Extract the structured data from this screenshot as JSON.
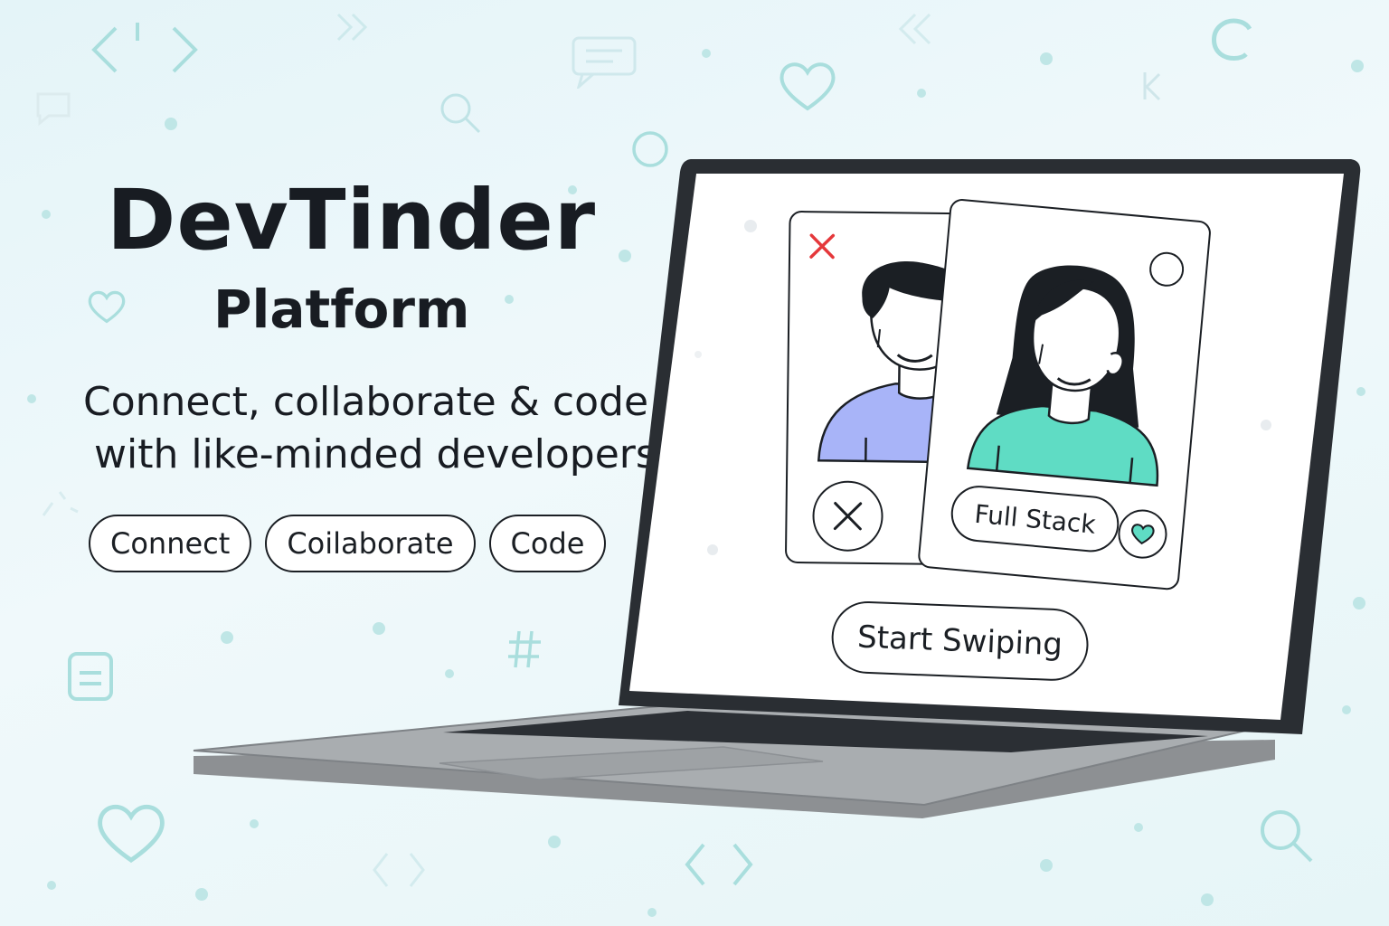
{
  "app": {
    "title": "DevTinder",
    "subtitle": "Platform",
    "tagline_line1": "Connect, collaborate & code",
    "tagline_line2": "with like-minded developers"
  },
  "pills": [
    {
      "label": "Connect"
    },
    {
      "label": "Coilaborate"
    },
    {
      "label": "Code"
    }
  ],
  "screen": {
    "left_card": {
      "reject_icon": "x-icon",
      "avatar": "male-developer-avatar",
      "shirt_color": "#a8b4f8"
    },
    "right_card": {
      "avatar": "female-developer-avatar",
      "shirt_color": "#5fdcc4",
      "badge": "Full Stack",
      "like_icon": "heart-icon"
    },
    "cta": "Start Swiping"
  },
  "colors": {
    "accent_teal": "#5fdcc4",
    "accent_lavender": "#a8b4f8",
    "reject_red": "#e5383b",
    "ink": "#1b1f24",
    "decor": "#a9dedd"
  }
}
